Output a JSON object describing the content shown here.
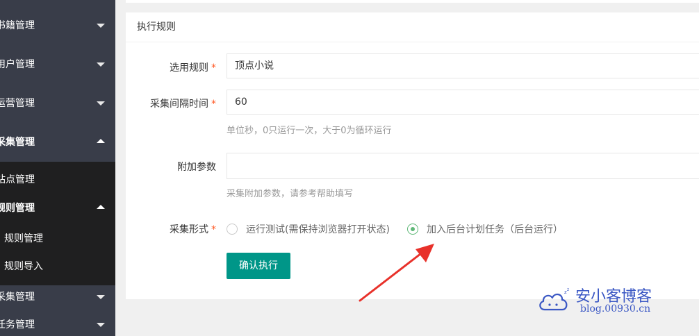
{
  "sidebar": {
    "items": [
      {
        "label": "书籍管理",
        "expanded": false
      },
      {
        "label": "用户管理",
        "expanded": false
      },
      {
        "label": "运营管理",
        "expanded": false
      },
      {
        "label": "采集管理",
        "expanded": true
      },
      {
        "label": "采集管理",
        "expanded": false
      },
      {
        "label": "任务管理",
        "expanded": false
      }
    ],
    "sub_items": [
      {
        "label": "站点管理",
        "expanded": false
      },
      {
        "label": "规则管理",
        "expanded": true
      }
    ],
    "sub_sub_items": [
      {
        "label": "规则管理"
      },
      {
        "label": "规则导入"
      }
    ]
  },
  "card": {
    "title": "执行规则",
    "fields": {
      "rule": {
        "label": "选用规则",
        "required": "*",
        "value": "顶点小说"
      },
      "interval": {
        "label": "采集间隔时间",
        "required": "*",
        "value": "60",
        "hint": "单位秒，0只运行一次，大于0为循环运行"
      },
      "params": {
        "label": "附加参数",
        "value": "",
        "hint": "采集附加参数，请参考帮助填写"
      },
      "mode": {
        "label": "采集形式",
        "required": "*",
        "options": [
          {
            "label": "运行测试(需保持浏览器打开状态)",
            "checked": false
          },
          {
            "label": "加入后台计划任务（后台运行）",
            "checked": true
          }
        ]
      }
    },
    "submit_label": "确认执行"
  },
  "watermark": {
    "title": "安小客博客",
    "url": "blog.00930.cn",
    "icon": "cloud-icon"
  },
  "colors": {
    "sidebar": "#393d49",
    "sidebar_sub": "#1f1f20",
    "primary": "#009688",
    "radio_checked": "#5fb878",
    "required": "#ff5722",
    "arrow": "#e8312a",
    "watermark": "#3a57c4"
  }
}
